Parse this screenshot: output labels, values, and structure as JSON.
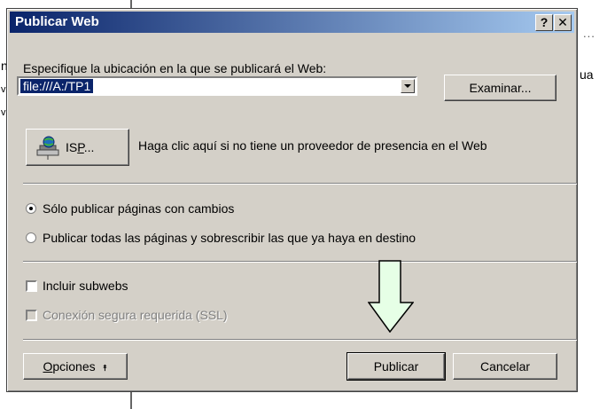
{
  "background": {
    "left_letters": [
      "n",
      "v",
      "v"
    ],
    "right_text": "ua"
  },
  "dialog": {
    "title": "Publicar Web",
    "help_button": "?",
    "close_button": "✕",
    "location_label": "Especifique la ubicación en la que se publicará el Web:",
    "location_value": "file:///A:/TP1",
    "browse_button": "Examinar...",
    "isp_button_prefix": "IS",
    "isp_button_accel": "P",
    "isp_button_suffix": "...",
    "isp_text": "Haga clic aquí si no tiene un proveedor de presencia en el Web",
    "radio_changed": "Sólo publicar páginas con cambios",
    "radio_all": "Publicar todas las páginas y sobrescribir las que ya haya en destino",
    "radio_changed_selected": true,
    "check_subwebs": "Incluir subwebs",
    "check_ssl": "Conexión segura requerida (SSL)",
    "options_accel": "O",
    "options_rest": "pciones",
    "options_chevron": "⯭",
    "publish_button": "Publicar",
    "cancel_button": "Cancelar"
  },
  "annotation": {
    "arrow_icon": "down-arrow-icon",
    "arrow_fill": "#e6ffe6",
    "arrow_stroke": "#000000"
  }
}
